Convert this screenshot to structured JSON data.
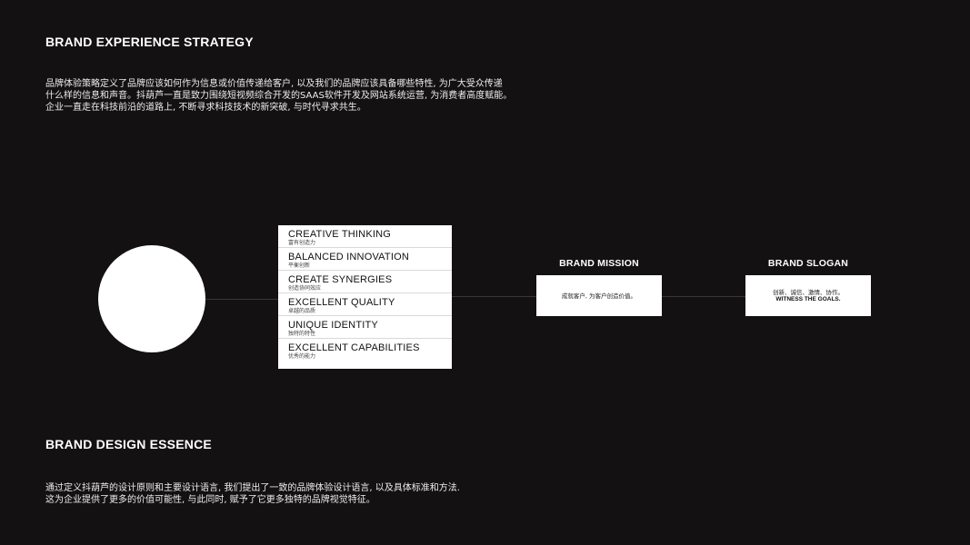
{
  "strategy": {
    "title": "BRAND EXPERIENCE STRATEGY",
    "lines": [
      "品牌体验策略定义了品牌应该如何作为信息或价值传递给客户, 以及我们的品牌应该具备哪些特性, 为广大受众传递",
      "什么样的信息和声音。抖葫芦一直是致力围绕短视频综合开发的SAAS软件开发及网站系统运营, 为消费者高度赋能。",
      "企业一直走在科技前沿的道路上, 不断寻求科技技术的新突破, 与时代寻求共生。"
    ]
  },
  "values": [
    {
      "title": "CREATIVE THINKING",
      "sub": "富有创造力"
    },
    {
      "title": "BALANCED INNOVATION",
      "sub": "平衡创新"
    },
    {
      "title": "CREATE SYNERGIES",
      "sub": "创造协同效应"
    },
    {
      "title": "EXCELLENT QUALITY",
      "sub": "卓越的品质"
    },
    {
      "title": "UNIQUE IDENTITY",
      "sub": "独特的特性"
    },
    {
      "title": "EXCELLENT CAPABILITIES",
      "sub": "优秀的能力"
    }
  ],
  "mission": {
    "label": "BRAND MISSION",
    "text": "成就客户, 为客户创造价值。"
  },
  "slogan": {
    "label": "BRAND SLOGAN",
    "line1": "创新、诚信、激情、协作。",
    "line2": "WITNESS THE GOALS."
  },
  "essence": {
    "title": "BRAND DESIGN ESSENCE",
    "lines": [
      "通过定义抖葫芦的设计原则和主要设计语言, 我们提出了一致的品牌体验设计语言, 以及具体标准和方法.",
      "这为企业提供了更多的价值可能性, 与此同时, 赋予了它更多独特的品牌视觉特征。"
    ]
  }
}
